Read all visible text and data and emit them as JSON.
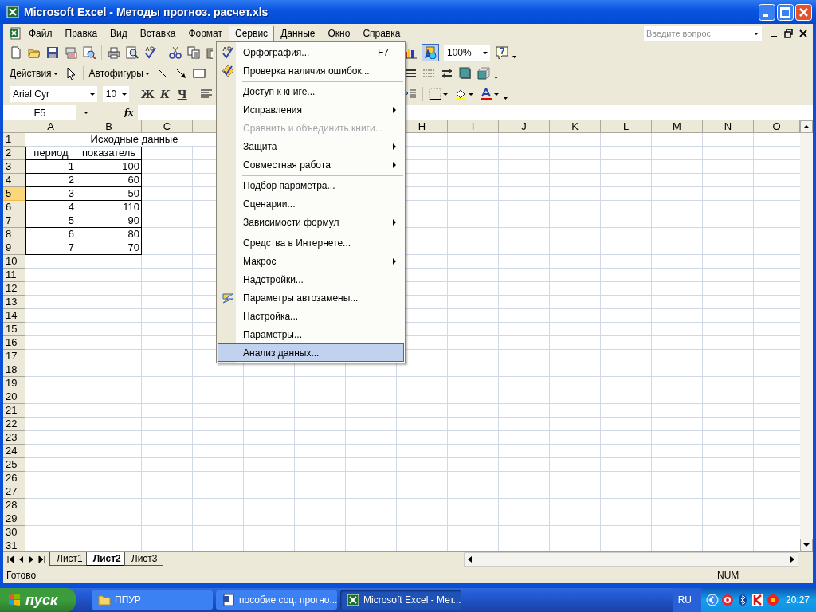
{
  "window": {
    "title": "Microsoft Excel - Методы прогноз. расчет.xls"
  },
  "menu_bar": [
    {
      "label": "Файл",
      "open": false
    },
    {
      "label": "Правка",
      "open": false
    },
    {
      "label": "Вид",
      "open": false
    },
    {
      "label": "Вставка",
      "open": false
    },
    {
      "label": "Формат",
      "open": false
    },
    {
      "label": "Сервис",
      "open": true
    },
    {
      "label": "Данные",
      "open": false
    },
    {
      "label": "Окно",
      "open": false
    },
    {
      "label": "Справка",
      "open": false
    }
  ],
  "help_box": {
    "placeholder": "Введите вопрос"
  },
  "toolbar": {
    "zoom": "100%",
    "actions": "Действия",
    "autoshapes": "Автофигуры",
    "font": "Arial Cyr",
    "size": "10",
    "bold": "Ж",
    "italic": "К",
    "underline": "Ч"
  },
  "formula_bar": {
    "name_box": "F5",
    "fx": "fx"
  },
  "sheet": {
    "columns": [
      "A",
      "B",
      "C",
      null,
      null,
      null,
      null,
      "H",
      "I",
      "J",
      "K",
      "L",
      "M",
      "N",
      "O"
    ],
    "rows": [
      {
        "header": "1",
        "selected": false,
        "kind": "title",
        "cells": [
          "Исходные данные"
        ]
      },
      {
        "header": "2",
        "selected": false,
        "kind": "heading",
        "cells": [
          "период",
          "показатель"
        ]
      },
      {
        "header": "3",
        "selected": false,
        "kind": "data",
        "cells": [
          "1",
          "100"
        ]
      },
      {
        "header": "4",
        "selected": false,
        "kind": "data",
        "cells": [
          "2",
          "60"
        ]
      },
      {
        "header": "5",
        "selected": true,
        "kind": "data",
        "cells": [
          "3",
          "50"
        ]
      },
      {
        "header": "6",
        "selected": false,
        "kind": "data",
        "cells": [
          "4",
          "110"
        ]
      },
      {
        "header": "7",
        "selected": false,
        "kind": "data",
        "cells": [
          "5",
          "90"
        ]
      },
      {
        "header": "8",
        "selected": false,
        "kind": "data",
        "cells": [
          "6",
          "80"
        ]
      },
      {
        "header": "9",
        "selected": false,
        "kind": "data",
        "cells": [
          "7",
          "70"
        ]
      },
      {
        "header": "10",
        "selected": false,
        "kind": "empty"
      },
      {
        "header": "11",
        "selected": false,
        "kind": "empty"
      },
      {
        "header": "12",
        "selected": false,
        "kind": "empty"
      },
      {
        "header": "13",
        "selected": false,
        "kind": "empty"
      },
      {
        "header": "14",
        "selected": false,
        "kind": "empty"
      },
      {
        "header": "15",
        "selected": false,
        "kind": "empty"
      },
      {
        "header": "16",
        "selected": false,
        "kind": "empty"
      },
      {
        "header": "17",
        "selected": false,
        "kind": "empty"
      },
      {
        "header": "18",
        "selected": false,
        "kind": "empty"
      },
      {
        "header": "19",
        "selected": false,
        "kind": "empty"
      },
      {
        "header": "20",
        "selected": false,
        "kind": "empty"
      },
      {
        "header": "21",
        "selected": false,
        "kind": "empty"
      },
      {
        "header": "22",
        "selected": false,
        "kind": "empty"
      },
      {
        "header": "23",
        "selected": false,
        "kind": "empty"
      },
      {
        "header": "24",
        "selected": false,
        "kind": "empty"
      },
      {
        "header": "25",
        "selected": false,
        "kind": "empty"
      },
      {
        "header": "26",
        "selected": false,
        "kind": "empty"
      },
      {
        "header": "27",
        "selected": false,
        "kind": "empty"
      },
      {
        "header": "28",
        "selected": false,
        "kind": "empty"
      },
      {
        "header": "29",
        "selected": false,
        "kind": "empty"
      },
      {
        "header": "30",
        "selected": false,
        "kind": "empty"
      },
      {
        "header": "31",
        "selected": false,
        "kind": "empty"
      }
    ]
  },
  "sheet_tabs": [
    {
      "label": "Лист1",
      "selected": false
    },
    {
      "label": "Лист2",
      "selected": true
    },
    {
      "label": "Лист3",
      "selected": false
    }
  ],
  "service_menu": [
    {
      "label": "Орфография...",
      "shortcut": "F7",
      "kind": "spelling",
      "submenu": false,
      "disabled": false,
      "selected": false,
      "separator_before": false
    },
    {
      "label": "Проверка наличия ошибок...",
      "kind": "error-check",
      "submenu": false,
      "disabled": false,
      "selected": false,
      "separator_before": false
    },
    {
      "label": "Доступ к книге...",
      "kind": "plain",
      "submenu": false,
      "disabled": false,
      "selected": false,
      "separator_before": true
    },
    {
      "label": "Исправления",
      "kind": "plain",
      "submenu": true,
      "disabled": false,
      "selected": false,
      "separator_before": false
    },
    {
      "label": "Сравнить и объединить книги...",
      "kind": "plain",
      "submenu": false,
      "disabled": true,
      "selected": false,
      "separator_before": false
    },
    {
      "label": "Защита",
      "kind": "plain",
      "submenu": true,
      "disabled": false,
      "selected": false,
      "separator_before": false
    },
    {
      "label": "Совместная работа",
      "kind": "plain",
      "submenu": true,
      "disabled": false,
      "selected": false,
      "separator_before": false
    },
    {
      "label": "Подбор параметра...",
      "kind": "plain",
      "submenu": false,
      "disabled": false,
      "selected": false,
      "separator_before": true
    },
    {
      "label": "Сценарии...",
      "kind": "plain",
      "submenu": false,
      "disabled": false,
      "selected": false,
      "separator_before": false
    },
    {
      "label": "Зависимости формул",
      "kind": "plain",
      "submenu": true,
      "disabled": false,
      "selected": false,
      "separator_before": false
    },
    {
      "label": "Средства в Интернете...",
      "kind": "plain",
      "submenu": false,
      "disabled": false,
      "selected": false,
      "separator_before": true
    },
    {
      "label": "Макрос",
      "kind": "plain",
      "submenu": true,
      "disabled": false,
      "selected": false,
      "separator_before": false
    },
    {
      "label": "Надстройки...",
      "kind": "plain",
      "submenu": false,
      "disabled": false,
      "selected": false,
      "separator_before": false
    },
    {
      "label": "Параметры автозамены...",
      "kind": "autocorrect",
      "submenu": false,
      "disabled": false,
      "selected": false,
      "separator_before": false
    },
    {
      "label": "Настройка...",
      "kind": "plain",
      "submenu": false,
      "disabled": false,
      "selected": false,
      "separator_before": false
    },
    {
      "label": "Параметры...",
      "kind": "plain",
      "submenu": false,
      "disabled": false,
      "selected": false,
      "separator_before": false
    },
    {
      "label": "Анализ данных...",
      "kind": "plain",
      "submenu": false,
      "disabled": false,
      "selected": true,
      "separator_before": false
    }
  ],
  "status_bar": {
    "status": "Готово",
    "num": "NUM"
  },
  "taskbar": {
    "start": "пуск",
    "tasks": [
      {
        "label": "ППУР",
        "kind": "folder",
        "selected": false
      },
      {
        "label": "пособие соц. прогно...",
        "kind": "word",
        "selected": false
      },
      {
        "label": "Microsoft Excel - Мет...",
        "kind": "excel",
        "selected": true
      }
    ],
    "language": "RU",
    "clock": "20:27"
  }
}
